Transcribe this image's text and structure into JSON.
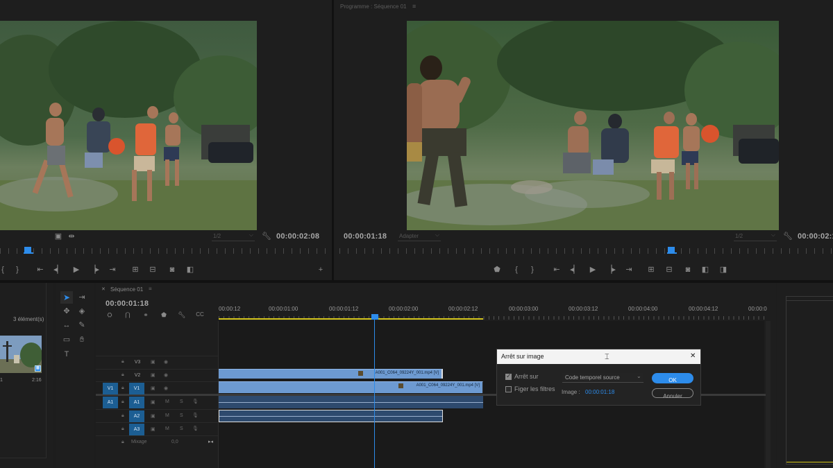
{
  "source_monitor": {
    "timecode": "00:00:02:08",
    "zoom": "1/2"
  },
  "program_monitor": {
    "title": "Programme : Séquence 01",
    "timecode_left": "00:00:01:18",
    "fit": "Adapter",
    "zoom": "1/2",
    "timecode_right": "00:00:02:1"
  },
  "project_panel": {
    "item_count": "3 élément(s)",
    "thumb_label_left": "1",
    "thumb_duration": "2:16"
  },
  "timeline": {
    "tab": "Séquence 01",
    "timecode": "00:00:01:18",
    "ruler_labels": [
      "00:00:12",
      "00:00:01:00",
      "00:00:01:12",
      "00:00:02:00",
      "00:00:02:12",
      "00:00:03:00",
      "00:00:03:12",
      "00:00:04:00",
      "00:00:04:12",
      "00:00:0"
    ],
    "tracks": {
      "v3": "V3",
      "v2": "V2",
      "v1_src": "V1",
      "v1": "V1",
      "a1_src": "A1",
      "a1": "A1",
      "a2": "A2",
      "a3": "A3",
      "m": "M",
      "s": "S",
      "mix_label": "Mixage",
      "mix_value": "0,0"
    },
    "clips": {
      "v2": "A001_C064_09224Y_001.mp4 [V]",
      "v1": "A001_C064_09224Y_001.mp4 [V]"
    }
  },
  "dialog": {
    "title": "Arrêt sur image",
    "hold_on_label": "Arrêt sur",
    "hold_on_checked": true,
    "hold_filters_label": "Figer les filtres",
    "hold_filters_checked": false,
    "dropdown_value": "Code temporel source",
    "image_label": "Image :",
    "image_value": "00:00:01:18",
    "ok_label": "OK",
    "cancel_label": "Annuler",
    "close_glyph": "✕"
  },
  "colors": {
    "accent": "#2d8ceb",
    "clip_video": "#6d9ad1",
    "clip_audio": "#2e4a6e",
    "track_active": "#1c5e93",
    "work_area": "#d5c61c"
  }
}
